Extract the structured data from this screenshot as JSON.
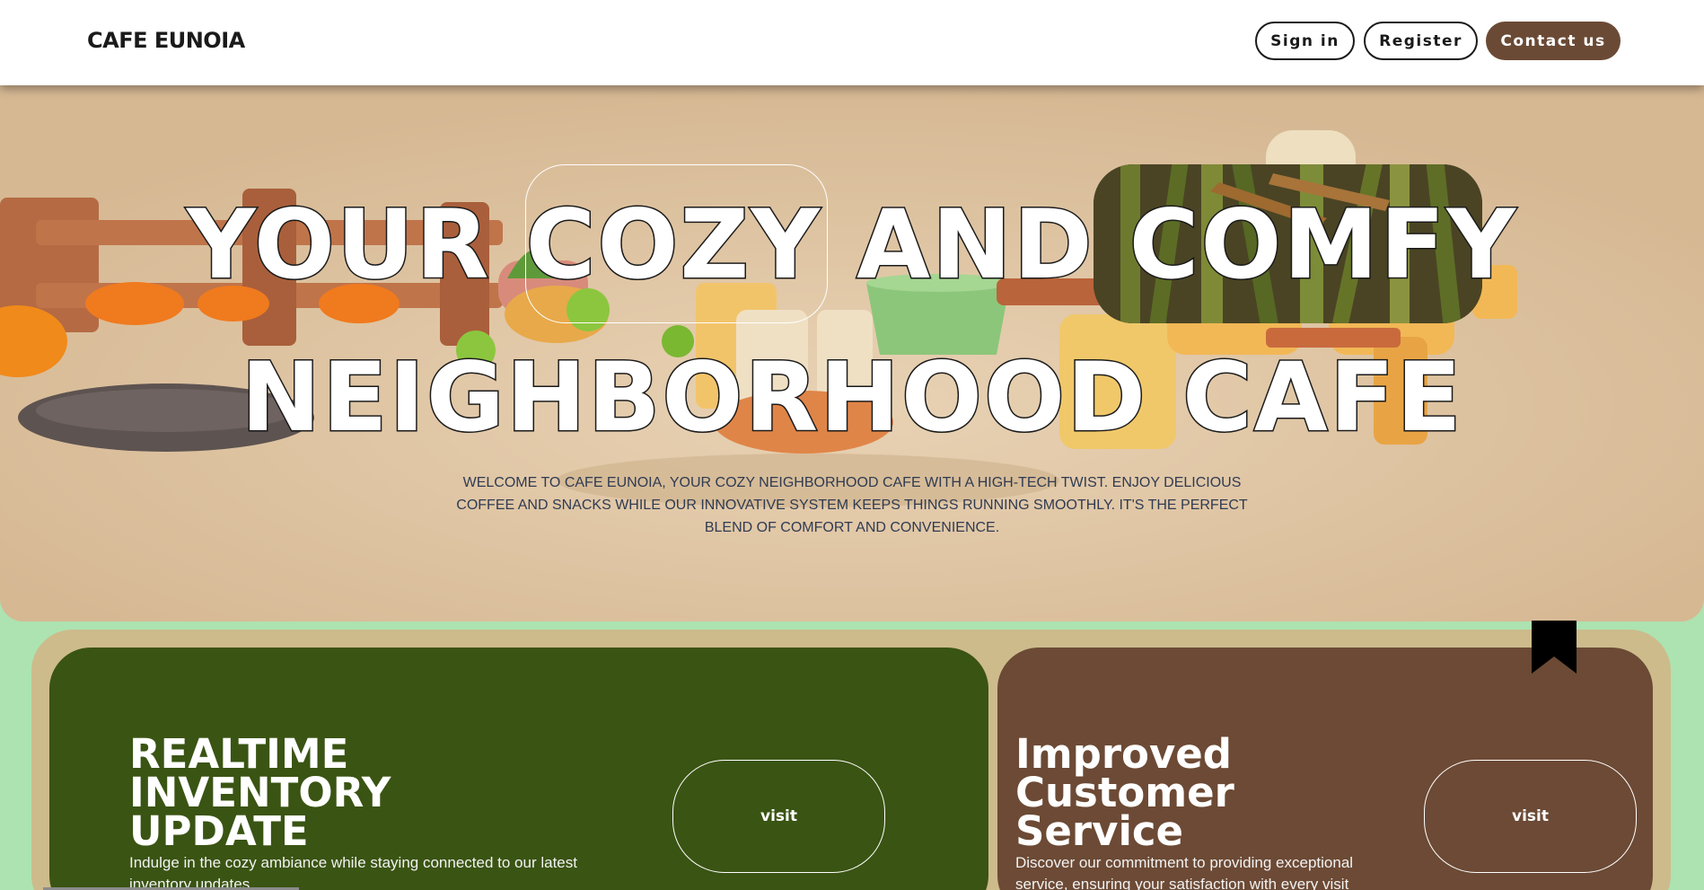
{
  "header": {
    "brand": "CAFE EUNOIA",
    "sign_in": "Sign in",
    "register": "Register",
    "contact": "Contact us"
  },
  "hero": {
    "title_line1": "YOUR COZY AND COMFY",
    "title_line2": "NEIGHBORHOOD CAFE",
    "description": "WELCOME TO CAFE EUNOIA, YOUR COZY NEIGHBORHOOD CAFE WITH A HIGH-TECH TWIST. ENJOY DELICIOUS COFFEE AND SNACKS WHILE OUR INNOVATIVE SYSTEM KEEPS THINGS RUNNING SMOOTHLY. IT'S THE PERFECT BLEND OF COMFORT AND CONVENIENCE."
  },
  "cards": [
    {
      "title_lines": [
        "REALTIME",
        "INVENTORY",
        "UPDATE"
      ],
      "text": "Indulge in the cozy ambiance while staying connected to our latest inventory updates",
      "button": "visit"
    },
    {
      "title_lines": [
        "Improved",
        "Customer",
        "Service"
      ],
      "text": "Discover our commitment to providing exceptional service, ensuring your satisfaction with every visit",
      "button": "visit"
    }
  ],
  "colors": {
    "contact_button": "#6b4a35",
    "hero_bg": "#dcbf9a",
    "page_bg": "#ace3b1",
    "card_green": "#3a5413",
    "card_brown": "#6c4a35",
    "card_frame": "#cdbb8c"
  },
  "icons": {
    "bookmark": "bookmark-icon"
  }
}
